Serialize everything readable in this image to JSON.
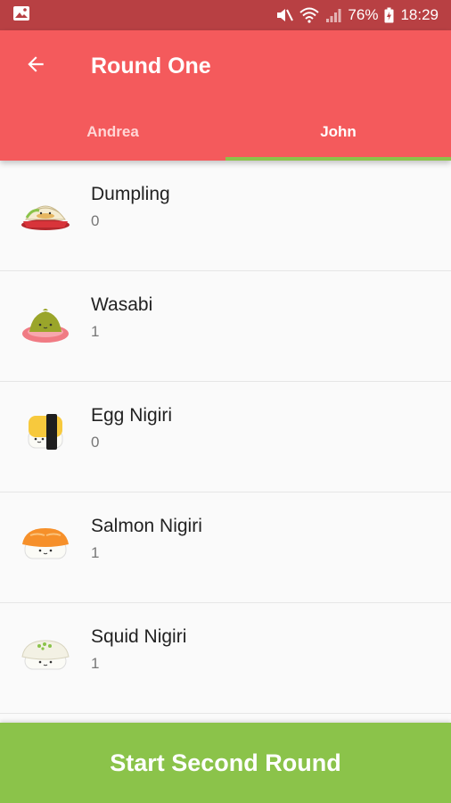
{
  "status_bar": {
    "battery": "76%",
    "time": "18:29"
  },
  "toolbar": {
    "title": "Round One"
  },
  "tabs": [
    {
      "label": "Andrea",
      "selected": false
    },
    {
      "label": "John",
      "selected": true
    }
  ],
  "items": [
    {
      "name": "Dumpling",
      "count": "0",
      "icon": "dumpling-icon"
    },
    {
      "name": "Wasabi",
      "count": "1",
      "icon": "wasabi-icon"
    },
    {
      "name": "Egg Nigiri",
      "count": "0",
      "icon": "egg-nigiri-icon"
    },
    {
      "name": "Salmon Nigiri",
      "count": "1",
      "icon": "salmon-nigiri-icon"
    },
    {
      "name": "Squid Nigiri",
      "count": "1",
      "icon": "squid-nigiri-icon"
    }
  ],
  "cta": {
    "label": "Start Second Round"
  },
  "colors": {
    "accent": "#f45a5c",
    "status_bar": "#b84043",
    "cta": "#8bc34a",
    "tab_indicator": "#8bc34a"
  }
}
